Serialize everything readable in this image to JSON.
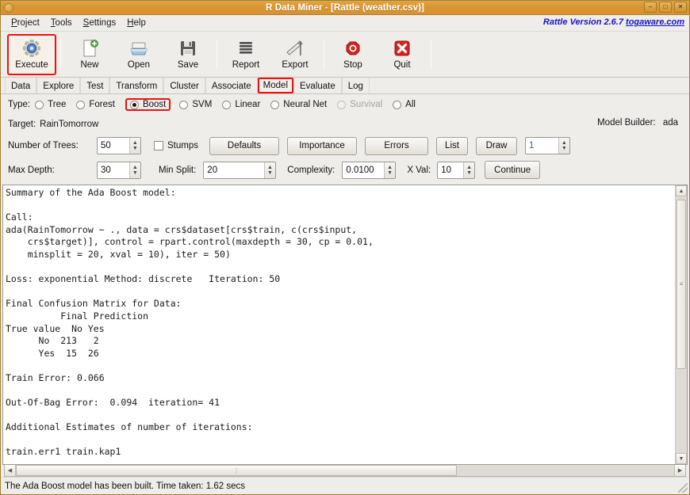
{
  "window": {
    "title": "R Data Miner - [Rattle (weather.csv)]",
    "icon": "app-icon",
    "buttons": [
      {
        "name": "minimize",
        "glyph": "–"
      },
      {
        "name": "maximize",
        "glyph": "□"
      },
      {
        "name": "close",
        "glyph": "✕"
      }
    ]
  },
  "menubar": {
    "items": [
      {
        "label": "Project",
        "mnemonic": "P"
      },
      {
        "label": "Tools",
        "mnemonic": "T"
      },
      {
        "label": "Settings",
        "mnemonic": "S"
      },
      {
        "label": "Help",
        "mnemonic": "H"
      }
    ],
    "version_text": "Rattle Version 2.6.7 ",
    "version_link": "togaware.com"
  },
  "toolbar": {
    "buttons": [
      {
        "label": "Execute",
        "icon": "gear-icon",
        "highlighted": true
      },
      {
        "label": "New",
        "icon": "new-document-icon",
        "highlighted": false
      },
      {
        "label": "Open",
        "icon": "open-folder-icon",
        "highlighted": false
      },
      {
        "label": "Save",
        "icon": "floppy-disk-icon",
        "highlighted": false
      },
      {
        "label": "Report",
        "icon": "report-lines-icon",
        "highlighted": false
      },
      {
        "label": "Export",
        "icon": "export-icon",
        "highlighted": false
      },
      {
        "label": "Stop",
        "icon": "stop-sign-icon",
        "highlighted": false
      },
      {
        "label": "Quit",
        "icon": "quit-x-icon",
        "highlighted": false
      }
    ]
  },
  "tabs": {
    "items": [
      {
        "label": "Data",
        "selected": false
      },
      {
        "label": "Explore",
        "selected": false
      },
      {
        "label": "Test",
        "selected": false
      },
      {
        "label": "Transform",
        "selected": false
      },
      {
        "label": "Cluster",
        "selected": false
      },
      {
        "label": "Associate",
        "selected": false
      },
      {
        "label": "Model",
        "selected": true
      },
      {
        "label": "Evaluate",
        "selected": false
      },
      {
        "label": "Log",
        "selected": false
      }
    ]
  },
  "model_panel": {
    "type_label": "Type:",
    "type_options": [
      {
        "label": "Tree",
        "selected": false,
        "disabled": false
      },
      {
        "label": "Forest",
        "selected": false,
        "disabled": false
      },
      {
        "label": "Boost",
        "selected": true,
        "disabled": false
      },
      {
        "label": "SVM",
        "selected": false,
        "disabled": false
      },
      {
        "label": "Linear",
        "selected": false,
        "disabled": false
      },
      {
        "label": "Neural Net",
        "selected": false,
        "disabled": false
      },
      {
        "label": "Survival",
        "selected": false,
        "disabled": true
      },
      {
        "label": "All",
        "selected": false,
        "disabled": false
      }
    ],
    "target_label": "Target:",
    "target_value": "RainTomorrow",
    "model_builder_label": "Model Builder:",
    "model_builder_value": "ada",
    "num_trees_label": "Number of Trees:",
    "num_trees_value": "50",
    "stumps_label": "Stumps",
    "stumps_checked": false,
    "defaults_label": "Defaults",
    "importance_label": "Importance",
    "errors_label": "Errors",
    "list_label": "List",
    "draw_label": "Draw",
    "draw_index_value": "1",
    "max_depth_label": "Max Depth:",
    "max_depth_value": "30",
    "min_split_label": "Min Split:",
    "min_split_value": "20",
    "complexity_label": "Complexity:",
    "complexity_value": "0.0100",
    "xval_label": "X Val:",
    "xval_value": "10",
    "continue_label": "Continue"
  },
  "output": {
    "text": "Summary of the Ada Boost model:\n\nCall:\nada(RainTomorrow ~ ., data = crs$dataset[crs$train, c(crs$input,\n    crs$target)], control = rpart.control(maxdepth = 30, cp = 0.01,\n    minsplit = 20, xval = 10), iter = 50)\n\nLoss: exponential Method: discrete   Iteration: 50\n\nFinal Confusion Matrix for Data:\n          Final Prediction\nTrue value  No Yes\n      No  213   2\n      Yes  15  26\n\nTrain Error: 0.066\n\nOut-Of-Bag Error:  0.094  iteration= 41\n\nAdditional Estimates of number of iterations:\n\ntrain.err1 train.kap1"
  },
  "statusbar": {
    "message": "The Ada Boost model has been built. Time taken: 1.62 secs"
  },
  "colors": {
    "titlebar": "#d9952f",
    "highlight_red": "#ee1111",
    "link_blue": "#1414c8",
    "panel_bg": "#efedea",
    "text_bg": "#ffffff"
  }
}
